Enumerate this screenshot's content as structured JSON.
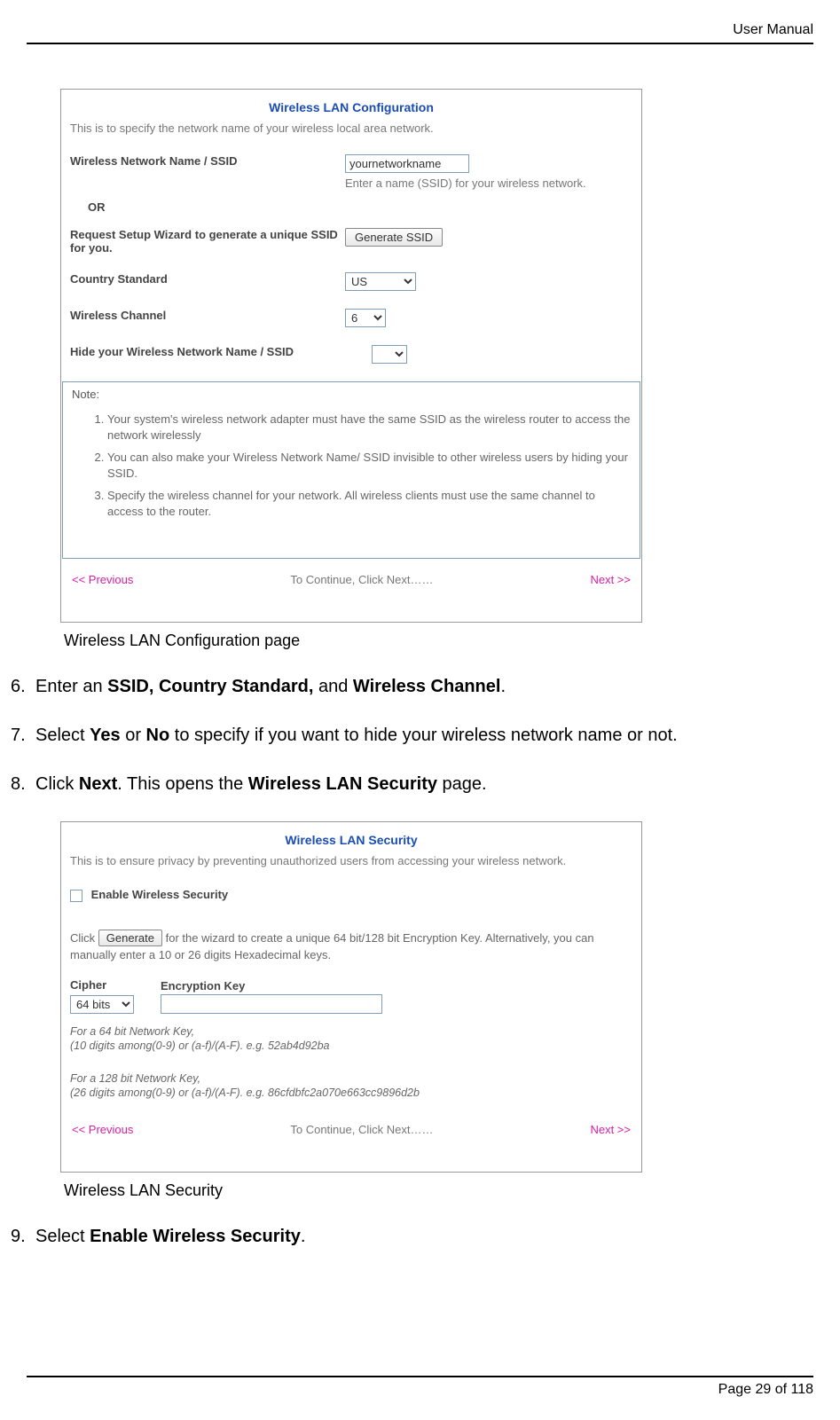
{
  "header": {
    "label": "User Manual"
  },
  "footer": {
    "text": "Page 29 of 118"
  },
  "panel1": {
    "title": "Wireless LAN Configuration",
    "intro": "This is to specify the network name of your wireless local area network.",
    "fields": {
      "ssid_label": "Wireless Network Name / SSID",
      "ssid_value": "yournetworkname",
      "ssid_help": "Enter a name (SSID) for your wireless network.",
      "or": "OR",
      "gen_label": "Request Setup Wizard to generate a unique SSID for you.",
      "gen_button": "Generate SSID",
      "country_label": "Country Standard",
      "country_value": "US",
      "channel_label": "Wireless Channel",
      "channel_value": "6",
      "hide_label": "Hide your Wireless Network Name / SSID",
      "hide_value": ""
    },
    "note": {
      "head": "Note:",
      "items": [
        "Your system's wireless network adapter must have the same SSID as the wireless router to access the network wirelessly",
        "You can also make your Wireless Network Name/ SSID invisible to other wireless users by hiding your SSID.",
        "Specify the wireless channel for your network. All wireless clients must use the same channel to access to the router."
      ]
    },
    "nav": {
      "prev": "<< Previous",
      "mid": "To Continue, Click Next……",
      "next": "Next >>"
    }
  },
  "caption1": "Wireless LAN Configuration page",
  "steps1": [
    {
      "pre": "Enter an ",
      "b1": "SSID, Country Standard,",
      "mid": " and ",
      "b2": "Wireless Channel",
      "post": "."
    },
    {
      "pre": "Select ",
      "b1": "Yes",
      "mid": " or ",
      "b2": "No",
      "post": " to specify if you want to hide your wireless network name or not."
    },
    {
      "pre": "Click ",
      "b1": "Next",
      "mid": ". This opens the ",
      "b2": "Wireless LAN Security",
      "post": " page."
    }
  ],
  "panel2": {
    "title": "Wireless LAN Security",
    "intro": "This is to ensure privacy by preventing unauthorized users from accessing your wireless network.",
    "enable_label": "Enable Wireless Security",
    "click_pre": "Click ",
    "generate_btn": "Generate",
    "click_post": " for the wizard to create a unique 64 bit/128 bit Encryption Key. Alternatively, you can manually enter a 10 or 26 digits Hexadecimal keys.",
    "cipher_label": "Cipher",
    "cipher_value": "64 bits",
    "enc_label": "Encryption Key",
    "hint64a": "For a 64 bit Network Key,",
    "hint64b": "(10 digits among(0-9) or (a-f)/(A-F). e.g. 52ab4d92ba",
    "hint128a": "For a 128 bit Network Key,",
    "hint128b": "(26 digits among(0-9) or (a-f)/(A-F). e.g. 86cfdbfc2a070e663cc9896d2b",
    "nav": {
      "prev": "<< Previous",
      "mid": "To Continue, Click Next……",
      "next": "Next >>"
    }
  },
  "caption2": "Wireless LAN Security",
  "steps2": [
    {
      "pre": "Select ",
      "b1": "Enable Wireless Security",
      "post": "."
    }
  ]
}
